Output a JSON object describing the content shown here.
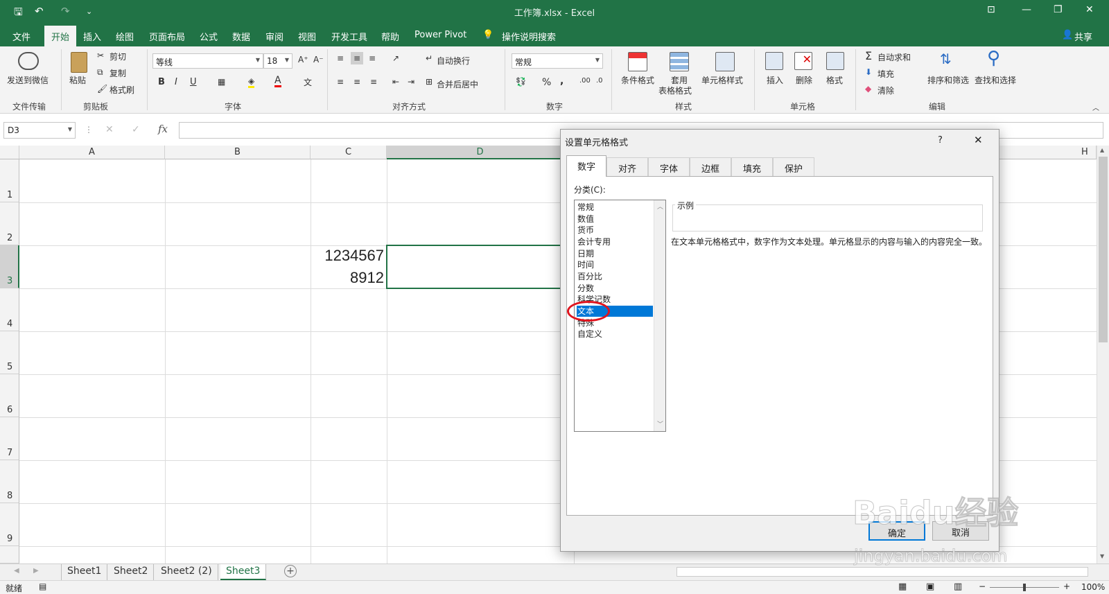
{
  "titlebar": {
    "title": "工作簿.xlsx  -  Excel",
    "qa_save": "🖫",
    "qa_undo": "↶",
    "qa_redo": "↷",
    "qa_more": "⌄",
    "min": "—",
    "max": "❐",
    "close": "✕",
    "restore": "⊡"
  },
  "menu": {
    "items": [
      "文件",
      "开始",
      "插入",
      "绘图",
      "页面布局",
      "公式",
      "数据",
      "审阅",
      "视图",
      "开发工具",
      "帮助",
      "Power Pivot"
    ],
    "search": "操作说明搜索",
    "share": "共享"
  },
  "ribbon": {
    "send_wechat": "发送到微信",
    "group_file": "文件传输",
    "paste": "粘贴",
    "cut": "剪切",
    "copy": "复制",
    "format_painter": "格式刷",
    "group_clipboard": "剪贴板",
    "font_name": "等线",
    "font_size": "18",
    "bold": "B",
    "italic": "I",
    "underline": "U",
    "group_font": "字体",
    "wrap_text": "自动换行",
    "merge_center": "合并后居中",
    "group_align": "对齐方式",
    "number_format": "常规",
    "percent": "%",
    "comma": ",",
    "group_number": "数字",
    "cond_format": "条件格式",
    "table_format_1": "套用",
    "table_format_2": "表格格式",
    "cell_style": "单元格样式",
    "group_style": "样式",
    "insert": "插入",
    "delete": "删除",
    "format": "格式",
    "group_cells": "单元格",
    "autosum": "自动求和",
    "fill": "填充",
    "clear": "清除",
    "sort_filter": "排序和筛选",
    "find_select": "查找和选择",
    "group_edit": "编辑"
  },
  "formula_bar": {
    "name_box": "D3",
    "fx": "fx",
    "cancel": "✕",
    "enter": "✓",
    "value": ""
  },
  "grid": {
    "columns": [
      "A",
      "B",
      "C",
      "D",
      "H"
    ],
    "rows": [
      "1",
      "2",
      "3",
      "4",
      "5",
      "6",
      "7",
      "8",
      "9"
    ],
    "c3_line1": "1234567",
    "c3_line2": "8912"
  },
  "sheets": {
    "tabs": [
      "Sheet1",
      "Sheet2",
      "Sheet2 (2)",
      "Sheet3"
    ],
    "active": "Sheet3",
    "add": "+"
  },
  "status": {
    "ready": "就绪",
    "zoom": "100%",
    "zoom_minus": "−",
    "zoom_plus": "+"
  },
  "dialog": {
    "title": "设置单元格格式",
    "help": "?",
    "close": "✕",
    "tabs": [
      "数字",
      "对齐",
      "字体",
      "边框",
      "填充",
      "保护"
    ],
    "category_label": "分类(C):",
    "categories": [
      "常规",
      "数值",
      "货币",
      "会计专用",
      "日期",
      "时间",
      "百分比",
      "分数",
      "科学记数",
      "文本",
      "特殊",
      "自定义"
    ],
    "selected_category": "文本",
    "sample_label": "示例",
    "description": "在文本单元格格式中，数字作为文本处理。单元格显示的内容与输入的内容完全一致。",
    "ok": "确定",
    "cancel": "取消"
  },
  "watermark": {
    "text": "Baidu经验",
    "url": "jingyan.baidu.com"
  },
  "colors": {
    "excel_green": "#217346",
    "selection_blue": "#0078d7",
    "annotation_red": "#e0141e"
  }
}
